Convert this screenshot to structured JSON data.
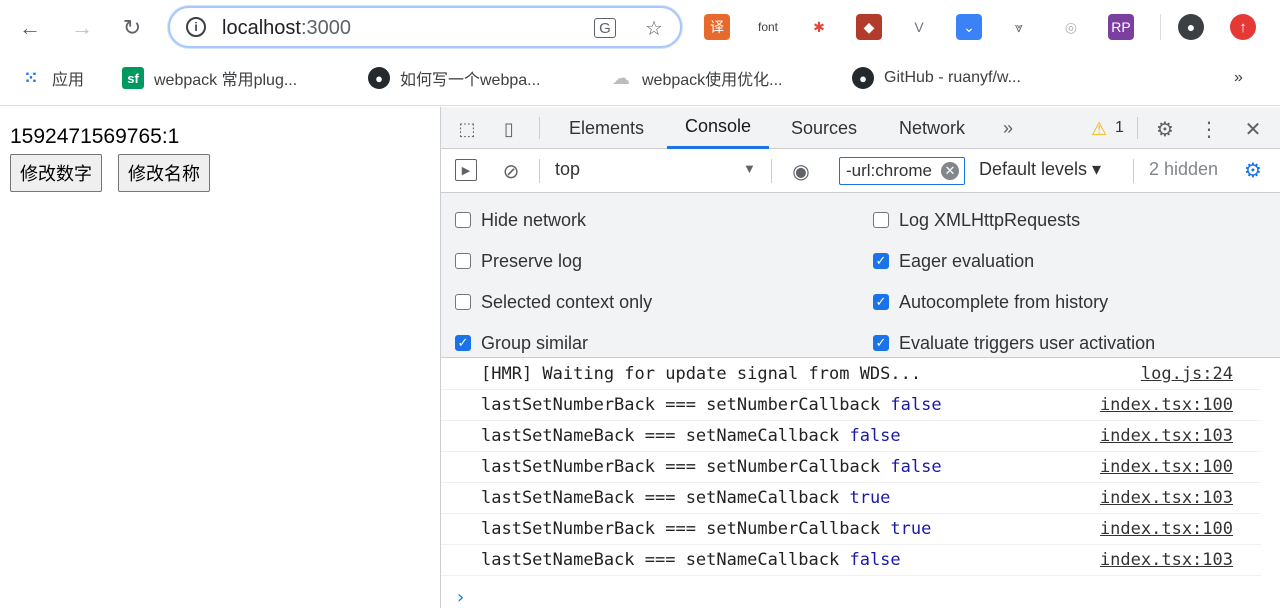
{
  "browser": {
    "url_host": "localhost",
    "url_port": ":3000",
    "extensions": [
      {
        "name": "translate-extension-icon",
        "glyph": "译",
        "color": "#ffffff",
        "bg": "#e8692c"
      },
      {
        "name": "font-extension-icon",
        "glyph": "font",
        "color": "#3c4043",
        "bg": "#ffffff"
      },
      {
        "name": "asterisk-extension-icon",
        "glyph": "✱",
        "color": "#e8453c",
        "bg": "#ffffff"
      },
      {
        "name": "red-extension-icon",
        "glyph": "◆",
        "color": "#ffffff",
        "bg": "#b23b2c"
      },
      {
        "name": "vue-extension-icon",
        "glyph": "V",
        "color": "#6b7280",
        "bg": "#ffffff"
      },
      {
        "name": "blue-check-extension-icon",
        "glyph": "⌄",
        "color": "#ffffff",
        "bg": "#3b82f6"
      },
      {
        "name": "chevrons-extension-icon",
        "glyph": "⩔",
        "color": "#5f6368",
        "bg": "#ffffff"
      },
      {
        "name": "ring-extension-icon",
        "glyph": "◎",
        "color": "#b0b0b0",
        "bg": "#ffffff"
      },
      {
        "name": "rp-extension-icon",
        "glyph": "RP",
        "color": "#ffffff",
        "bg": "#7b3fa0"
      }
    ],
    "bookmarks": [
      {
        "label": "应用",
        "icon": "apps-grid-icon"
      },
      {
        "label": "webpack 常用plug...",
        "icon": "sf-icon"
      },
      {
        "label": "如何写一个webpa...",
        "icon": "github-icon"
      },
      {
        "label": "webpack使用优化...",
        "icon": "cloud-icon"
      },
      {
        "label": "GitHub - ruanyf/w...",
        "icon": "github-icon"
      }
    ],
    "bookmarks_more": "»"
  },
  "page": {
    "counter_text": "1592471569765:1",
    "button_change_number": "修改数字",
    "button_change_name": "修改名称"
  },
  "devtools": {
    "tabs": [
      "Elements",
      "Console",
      "Sources",
      "Network"
    ],
    "active_tab": "Console",
    "more_tabs": "»",
    "warning_count": "1",
    "context": "top",
    "filter_value": "-url:chrome",
    "levels": "Default levels ▾",
    "hidden": "2 hidden",
    "settings_left": [
      "Hide network",
      "Preserve log",
      "Selected context only",
      "Group similar"
    ],
    "settings_left_checked": [
      false,
      false,
      false,
      true
    ],
    "settings_right": [
      "Log XMLHttpRequests",
      "Eager evaluation",
      "Autocomplete from history",
      "Evaluate triggers user activation"
    ],
    "settings_right_checked": [
      false,
      true,
      true,
      true
    ],
    "logs": [
      {
        "text": "[HMR] Waiting for update signal from WDS...",
        "value": "",
        "source": "log.js:24"
      },
      {
        "text": "lastSetNumberBack === setNumberCallback ",
        "value": "false",
        "source": "index.tsx:100"
      },
      {
        "text": "lastSetNameBack === setNameCallback ",
        "value": "false",
        "source": "index.tsx:103"
      },
      {
        "text": "lastSetNumberBack === setNumberCallback ",
        "value": "false",
        "source": "index.tsx:100"
      },
      {
        "text": "lastSetNameBack === setNameCallback ",
        "value": "true",
        "source": "index.tsx:103"
      },
      {
        "text": "lastSetNumberBack === setNumberCallback ",
        "value": "true",
        "source": "index.tsx:100"
      },
      {
        "text": "lastSetNameBack === setNameCallback ",
        "value": "false",
        "source": "index.tsx:103"
      }
    ],
    "prompt": "›"
  },
  "colors": {
    "accent": "#1a73e8",
    "boolean": "#1a1aa6",
    "warning": "#f4b400"
  }
}
